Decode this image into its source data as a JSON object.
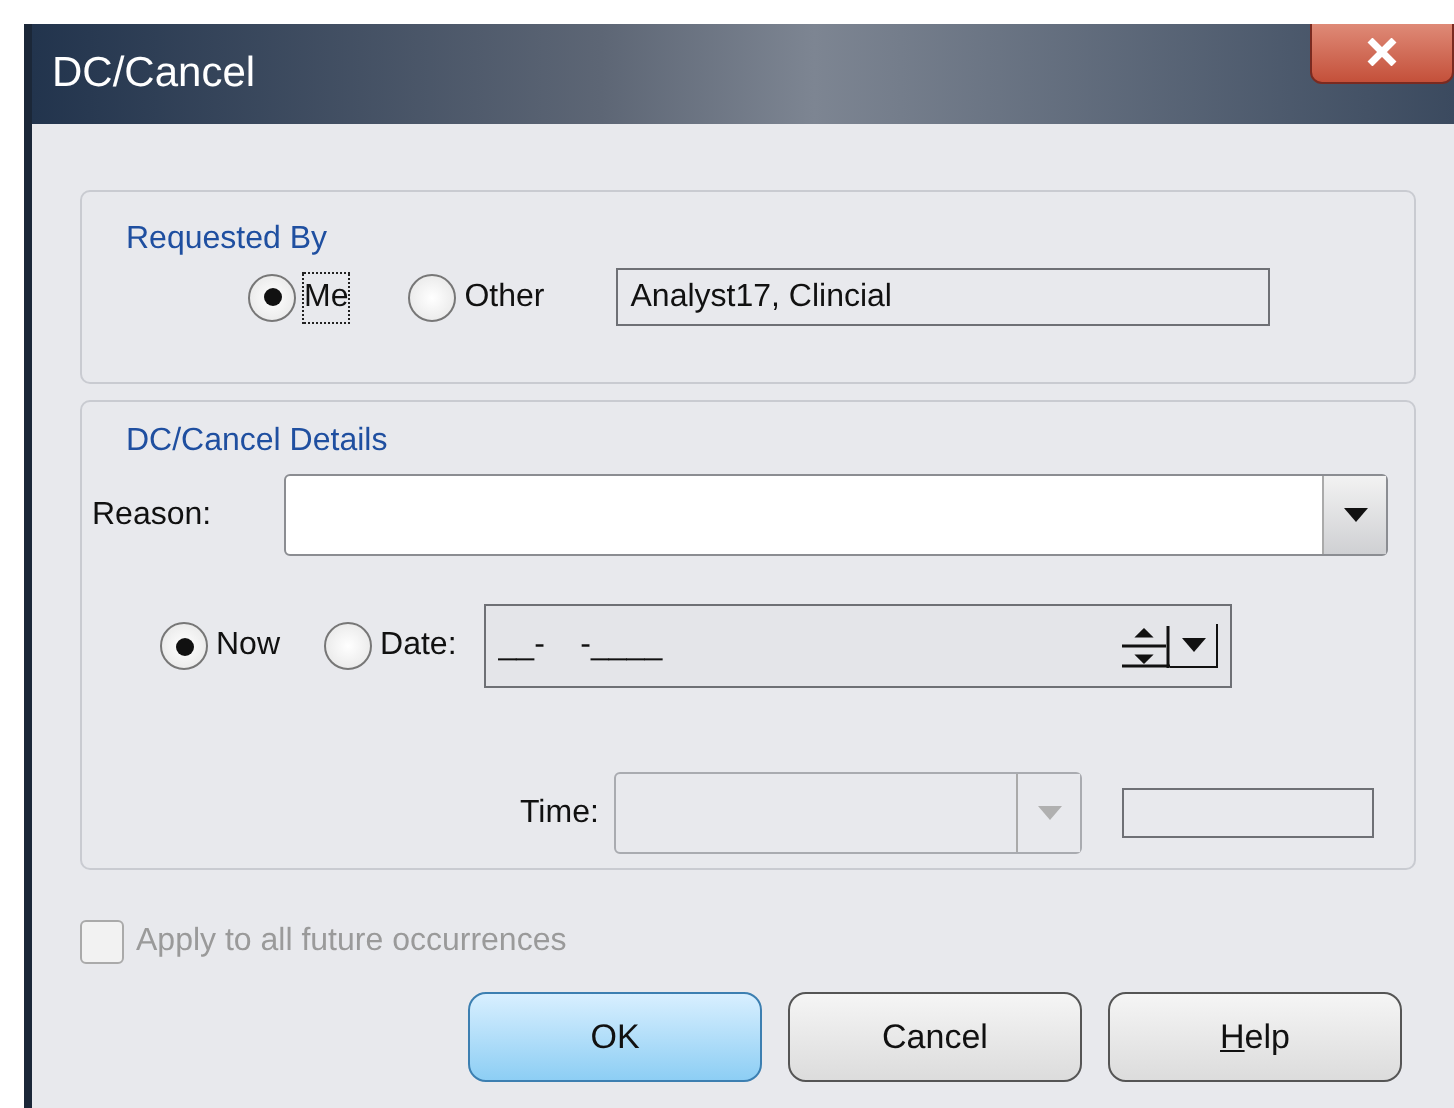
{
  "window": {
    "title": "DC/Cancel"
  },
  "requested_by": {
    "legend": "Requested By",
    "options": [
      {
        "label": "Me",
        "selected": true,
        "focused": true
      },
      {
        "label": "Other",
        "selected": false,
        "focused": false
      }
    ],
    "name_field": {
      "value": "Analyst17, Clincial"
    }
  },
  "details": {
    "legend": "DC/Cancel Details",
    "reason": {
      "label": "Reason:"
    },
    "timing": [
      {
        "label": "Now",
        "selected": true
      },
      {
        "label": "Date:",
        "selected": false
      }
    ],
    "date_field": {
      "value": "__-    -____"
    },
    "time": {
      "label": "Time:",
      "disabled": true
    }
  },
  "apply_all": {
    "label": "Apply to all future occurrences",
    "checked": false,
    "disabled": true
  },
  "buttons": [
    {
      "label": "OK",
      "default": true,
      "underline_first": false
    },
    {
      "label": "Cancel",
      "default": false,
      "underline_first": false
    },
    {
      "label": "Help",
      "default": false,
      "underline_first": true
    }
  ]
}
